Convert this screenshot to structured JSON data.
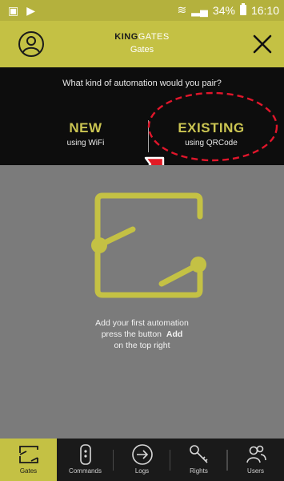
{
  "status_bar": {
    "signal_pct": "34%",
    "time": "16:10"
  },
  "header": {
    "brand_bold": "KING",
    "brand_light": "GATES",
    "title": "Gates"
  },
  "pair_panel": {
    "question": "What kind of automation would you pair?",
    "new_label": "NEW",
    "new_sub": "using WiFi",
    "existing_label": "EXISTING",
    "existing_sub": "using QRCode"
  },
  "empty_state": {
    "line1": "Add your first automation",
    "line2_pre": "press the button",
    "line2_button": "Add",
    "line3": "on the top right"
  },
  "tabs": [
    {
      "label": "Gates",
      "icon": "gate-icon",
      "active": true
    },
    {
      "label": "Commands",
      "icon": "remote-icon",
      "active": false
    },
    {
      "label": "Logs",
      "icon": "log-in-icon",
      "active": false
    },
    {
      "label": "Rights",
      "icon": "key-icon",
      "active": false
    },
    {
      "label": "Users",
      "icon": "users-icon",
      "active": false
    }
  ],
  "colors": {
    "accent": "#c4c144",
    "highlight": "#e0162b"
  }
}
